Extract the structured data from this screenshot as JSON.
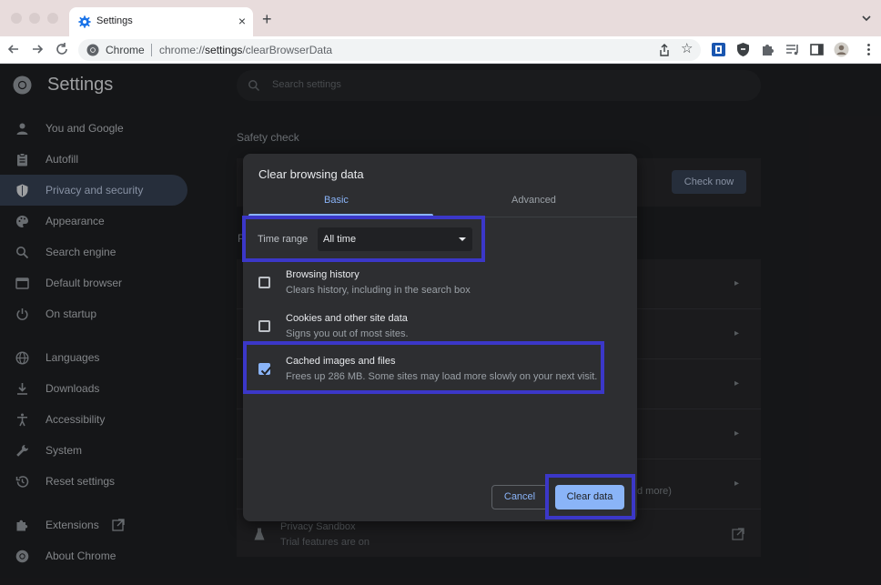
{
  "browser": {
    "tab_title": "Settings",
    "tab_close": "×",
    "new_tab": "+",
    "omnibox_label": "Chrome",
    "url_prefix": "chrome://",
    "url_path": "settings",
    "url_suffix": "/clearBrowserData",
    "star": "☆"
  },
  "header": {
    "title": "Settings",
    "search_placeholder": "Search settings"
  },
  "sidebar": {
    "items": [
      {
        "label": "You and Google",
        "icon": "person-icon"
      },
      {
        "label": "Autofill",
        "icon": "clipboard-icon"
      },
      {
        "label": "Privacy and security",
        "icon": "shield-icon",
        "active": true
      },
      {
        "label": "Appearance",
        "icon": "palette-icon"
      },
      {
        "label": "Search engine",
        "icon": "search-icon"
      },
      {
        "label": "Default browser",
        "icon": "browser-window-icon"
      },
      {
        "label": "On startup",
        "icon": "power-icon"
      },
      {
        "label": "Languages",
        "icon": "globe-icon"
      },
      {
        "label": "Downloads",
        "icon": "download-icon"
      },
      {
        "label": "Accessibility",
        "icon": "accessibility-icon"
      },
      {
        "label": "System",
        "icon": "wrench-icon"
      },
      {
        "label": "Reset settings",
        "icon": "history-icon"
      },
      {
        "label": "Extensions",
        "icon": "puzzle-icon"
      },
      {
        "label": "About Chrome",
        "icon": "chrome-icon"
      }
    ]
  },
  "background": {
    "safety_check_title": "Safety check",
    "check_now": "Check now",
    "privacy_section_initial": "P",
    "more_text": "d more)",
    "privacy_sandbox_title": "Privacy Sandbox",
    "privacy_sandbox_sub": "Trial features are on"
  },
  "dialog": {
    "title": "Clear browsing data",
    "tabs": [
      {
        "label": "Basic",
        "selected": true
      },
      {
        "label": "Advanced",
        "selected": false
      }
    ],
    "time_range_label": "Time range",
    "time_range_value": "All time",
    "options": [
      {
        "title": "Browsing history",
        "subtitle": "Clears history, including in the search box",
        "checked": false
      },
      {
        "title": "Cookies and other site data",
        "subtitle": "Signs you out of most sites.",
        "checked": false
      },
      {
        "title": "Cached images and files",
        "subtitle": "Frees up 286 MB. Some sites may load more slowly on your next visit.",
        "checked": true
      }
    ],
    "cancel_label": "Cancel",
    "clear_label": "Clear data"
  },
  "colors": {
    "accent": "#8ab4f8",
    "highlight": "#3b37c8",
    "page_bg": "#202124"
  }
}
